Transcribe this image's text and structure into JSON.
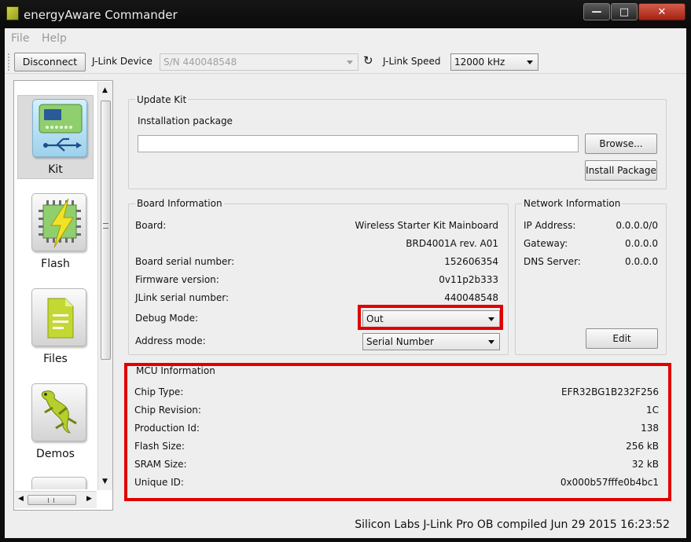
{
  "window": {
    "title": "energyAware Commander",
    "minimize_icon": "minimize-icon",
    "maximize_icon": "maximize-icon",
    "close_icon": "close-icon"
  },
  "menu": {
    "file": "File",
    "help": "Help"
  },
  "toolbar": {
    "disconnect_label": "Disconnect",
    "jlink_device_label": "J-Link Device",
    "jlink_device_value": "S/N 440048548",
    "refresh_icon": "refresh-icon",
    "jlink_speed_label": "J-Link Speed",
    "jlink_speed_value": "12000 kHz"
  },
  "sidebar": {
    "items": [
      {
        "label": "Kit",
        "icon": "kit-board-icon",
        "active": true
      },
      {
        "label": "Flash",
        "icon": "flash-chip-icon",
        "active": false
      },
      {
        "label": "Files",
        "icon": "files-icon",
        "active": false
      },
      {
        "label": "Demos",
        "icon": "gecko-icon",
        "active": false
      }
    ]
  },
  "update_kit": {
    "title": "Update Kit",
    "installation_label": "Installation package",
    "installation_value": "",
    "browse_label": "Browse...",
    "install_label": "Install Package"
  },
  "board_info": {
    "title": "Board Information",
    "board_label": "Board:",
    "board_value_1": "Wireless Starter Kit Mainboard",
    "board_value_2": "BRD4001A rev. A01",
    "serial_label": "Board serial number:",
    "serial_value": "152606354",
    "firmware_label": "Firmware version:",
    "firmware_value": "0v11p2b333",
    "jlink_serial_label": "JLink serial number:",
    "jlink_serial_value": "440048548",
    "debug_mode_label": "Debug Mode:",
    "debug_mode_value": "Out",
    "address_mode_label": "Address mode:",
    "address_mode_value": "Serial Number"
  },
  "network_info": {
    "title": "Network Information",
    "ip_label": "IP Address:",
    "ip_value": "0.0.0.0/0",
    "gateway_label": "Gateway:",
    "gateway_value": "0.0.0.0",
    "dns_label": "DNS Server:",
    "dns_value": "0.0.0.0",
    "edit_label": "Edit"
  },
  "mcu_info": {
    "title": "MCU Information",
    "rows": [
      {
        "label": "Chip Type:",
        "value": "EFR32BG1B232F256"
      },
      {
        "label": "Chip Revision:",
        "value": "1C"
      },
      {
        "label": "Production Id:",
        "value": "138"
      },
      {
        "label": "Flash Size:",
        "value": "256 kB"
      },
      {
        "label": "SRAM Size:",
        "value": "32 kB"
      },
      {
        "label": "Unique ID:",
        "value": "0x000b57fffe0b4bc1"
      }
    ]
  },
  "status_bar": {
    "text": "Silicon Labs J-Link Pro OB compiled Jun 29 2015 16:23:52"
  },
  "colors": {
    "highlight": "#e00000",
    "panel": "#eeeeee",
    "titlebar": "#0d0d0d"
  }
}
